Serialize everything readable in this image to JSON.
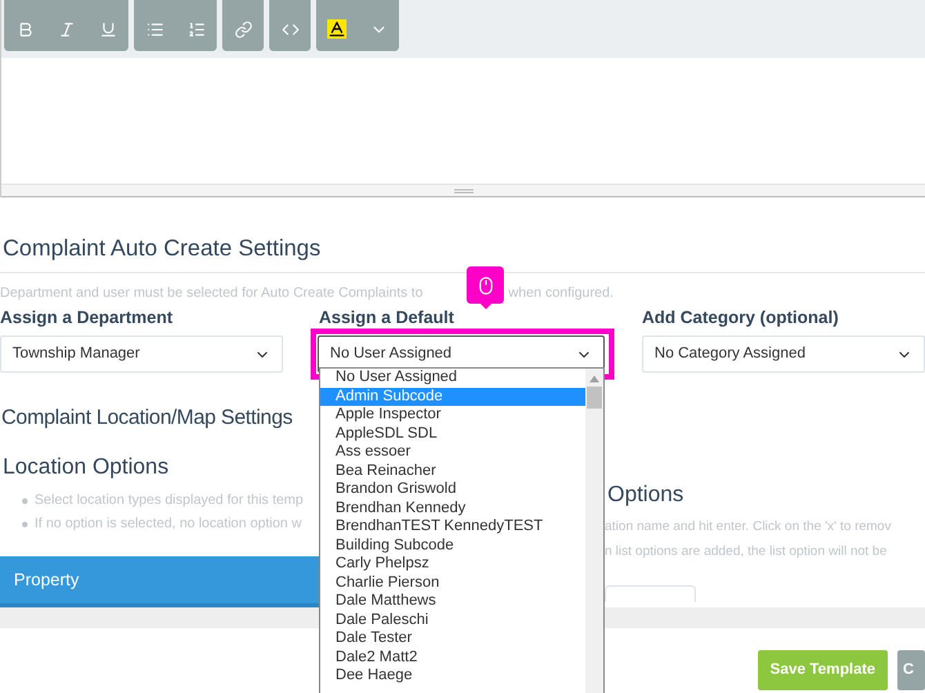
{
  "toolbar": {
    "groups": [
      {
        "buttons": [
          {
            "kind": "bold"
          },
          {
            "kind": "italic"
          },
          {
            "kind": "underline"
          }
        ]
      },
      {
        "buttons": [
          {
            "kind": "bullets"
          },
          {
            "kind": "numbers"
          }
        ]
      },
      {
        "buttons": [
          {
            "kind": "link"
          }
        ]
      },
      {
        "buttons": [
          {
            "kind": "code"
          }
        ]
      },
      {
        "buttons": [
          {
            "kind": "highlight"
          },
          {
            "kind": "caret"
          }
        ]
      }
    ]
  },
  "auto_create": {
    "title": "Complaint Auto Create Settings",
    "hint_before": "Department and user must be selected for Auto Create Complaints to",
    "hint_after": "when configured.",
    "fields": [
      {
        "label": "Assign a Department",
        "value": "Township Manager",
        "highlighted": false
      },
      {
        "label": "Assign a Default",
        "value": "No User Assigned",
        "highlighted": true
      },
      {
        "label": "Add Category (optional)",
        "value": "No Category Assigned",
        "highlighted": false
      }
    ]
  },
  "dropdown": {
    "options": [
      {
        "label": "No User Assigned",
        "selected": false
      },
      {
        "label": "Admin Subcode",
        "selected": true
      },
      {
        "label": "Apple Inspector",
        "selected": false
      },
      {
        "label": "AppleSDL SDL",
        "selected": false
      },
      {
        "label": "Ass essoer",
        "selected": false
      },
      {
        "label": "Bea Reinacher",
        "selected": false
      },
      {
        "label": "Brandon Griswold",
        "selected": false
      },
      {
        "label": "Brendhan Kennedy",
        "selected": false
      },
      {
        "label": "BrendhanTEST KennedyTEST",
        "selected": false
      },
      {
        "label": "Building Subcode",
        "selected": false
      },
      {
        "label": "Carly Phelpsz",
        "selected": false
      },
      {
        "label": "Charlie Pierson",
        "selected": false
      },
      {
        "label": "Dale Matthews",
        "selected": false
      },
      {
        "label": "Dale Paleschi",
        "selected": false
      },
      {
        "label": "Dale Tester",
        "selected": false
      },
      {
        "label": "Dale2 Matt2",
        "selected": false
      },
      {
        "label": "Dee Haege",
        "selected": false
      }
    ]
  },
  "location": {
    "title": "Complaint Location/Map Settings",
    "left_heading": "Location Options",
    "left_bullets": [
      "Select location types displayed for this temp",
      "If no option is selected, no location option w"
    ],
    "property_tab": "Property",
    "right_heading": "Options",
    "right_lines": [
      "ation name and hit enter. Click on the 'x' to remov",
      "n list options are added, the list option will not be"
    ]
  },
  "buttons": [
    {
      "label": "Save Template",
      "kind": "primary"
    },
    {
      "label": "C",
      "kind": "secondary"
    }
  ]
}
